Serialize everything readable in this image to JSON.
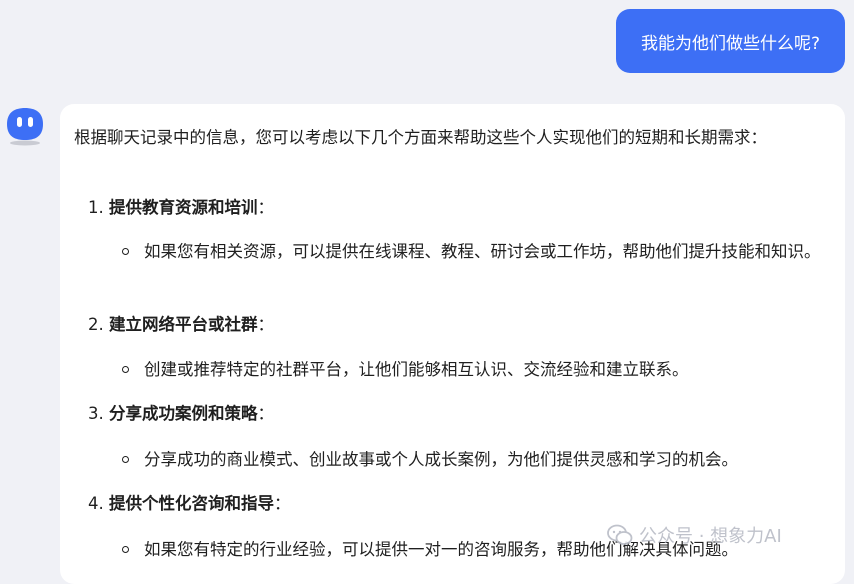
{
  "user_message": "我能为他们做些什么呢?",
  "assistant": {
    "intro": "根据聊天记录中的信息，您可以考虑以下几个方面来帮助这些个人实现他们的短期和长期需求：",
    "items": [
      {
        "number": "1.",
        "title": "提供教育资源和培训",
        "colon": "：",
        "bullet": "如果您有相关资源，可以提供在线课程、教程、研讨会或工作坊，帮助他们提升技能和知识。"
      },
      {
        "number": "2.",
        "title": "建立网络平台或社群",
        "colon": "：",
        "bullet": "创建或推荐特定的社群平台，让他们能够相互认识、交流经验和建立联系。"
      },
      {
        "number": "3.",
        "title": "分享成功案例和策略",
        "colon": "：",
        "bullet": "分享成功的商业模式、创业故事或个人成长案例，为他们提供灵感和学习的机会。"
      },
      {
        "number": "4.",
        "title": "提供个性化咨询和指导",
        "colon": "：",
        "bullet": "如果您有特定的行业经验，可以提供一对一的咨询服务，帮助他们解决具体问题。"
      }
    ]
  },
  "watermark": "公众号 · 想象力AI",
  "colors": {
    "user_bubble": "#3d6ff5",
    "avatar": "#3d6ff5",
    "background": "#f0f1f6"
  },
  "icons": {
    "avatar": "bot-avatar-icon",
    "watermark": "wechat-icon"
  }
}
